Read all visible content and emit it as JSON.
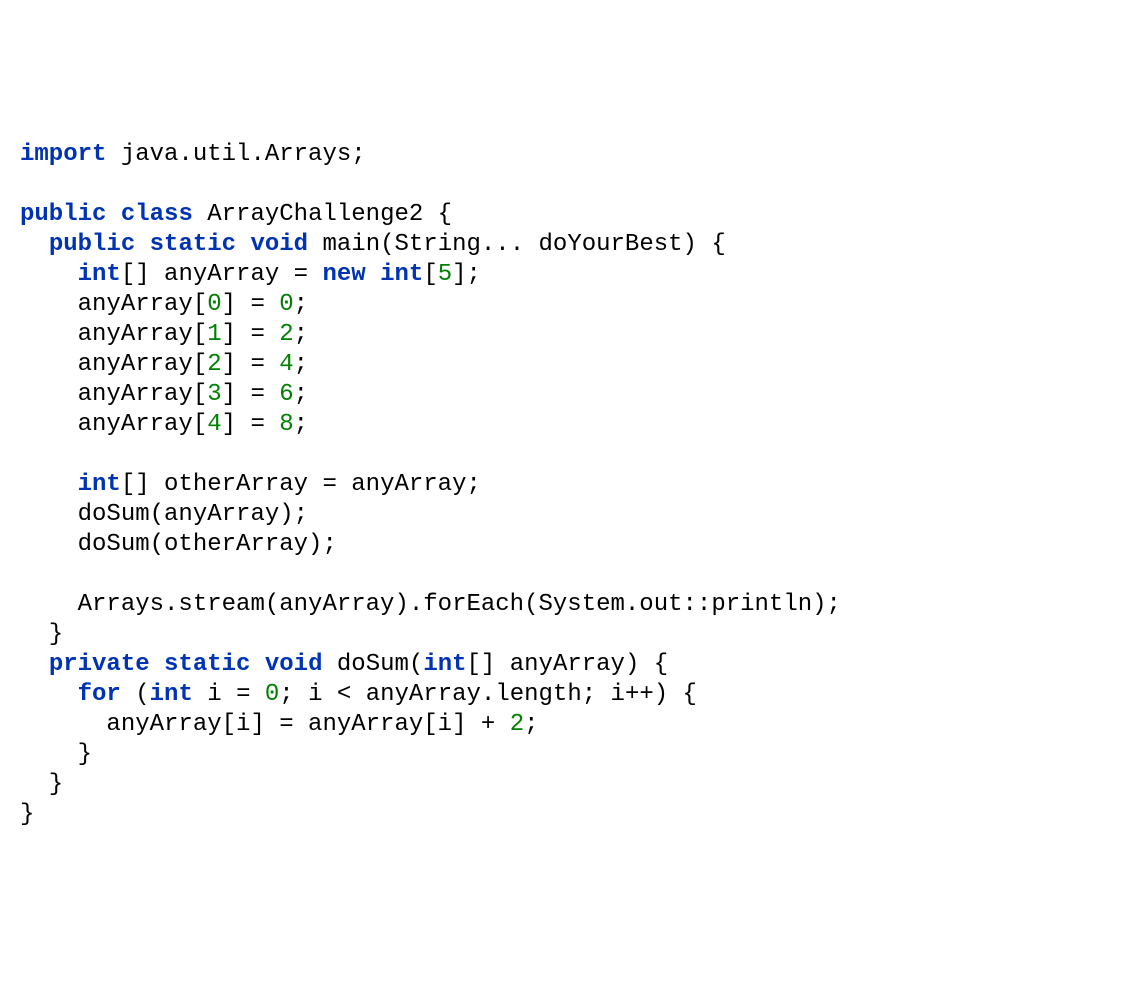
{
  "code": {
    "l1_import": "import",
    "l1_rest": " java.util.Arrays;",
    "l3_public": "public",
    "l3_class": "class",
    "l3_rest": " ArrayChallenge2 {",
    "l4_indent": "  ",
    "l4_public": "public",
    "l4_static": "static",
    "l4_void": "void",
    "l4_rest": " main(String... doYourBest) {",
    "l5_indent": "    ",
    "l5_int": "int",
    "l5_mid": "[] anyArray = ",
    "l5_new": "new",
    "l5_sp": " ",
    "l5_int2": "int",
    "l5_br1": "[",
    "l5_n": "5",
    "l5_br2": "];",
    "l6_indent": "    anyArray[",
    "l6_n": "0",
    "l6_mid": "] = ",
    "l6_v": "0",
    "l6_end": ";",
    "l7_indent": "    anyArray[",
    "l7_n": "1",
    "l7_mid": "] = ",
    "l7_v": "2",
    "l7_end": ";",
    "l8_indent": "    anyArray[",
    "l8_n": "2",
    "l8_mid": "] = ",
    "l8_v": "4",
    "l8_end": ";",
    "l9_indent": "    anyArray[",
    "l9_n": "3",
    "l9_mid": "] = ",
    "l9_v": "6",
    "l9_end": ";",
    "l10_indent": "    anyArray[",
    "l10_n": "4",
    "l10_mid": "] = ",
    "l10_v": "8",
    "l10_end": ";",
    "l12_indent": "    ",
    "l12_int": "int",
    "l12_rest": "[] otherArray = anyArray;",
    "l13": "    doSum(anyArray);",
    "l14": "    doSum(otherArray);",
    "l16": "    Arrays.stream(anyArray).forEach(System.out::println);",
    "l17": "  }",
    "l18_indent": "  ",
    "l18_private": "private",
    "l18_static": "static",
    "l18_void": "void",
    "l18_mid": " doSum(",
    "l18_int": "int",
    "l18_rest": "[] anyArray) {",
    "l19_indent": "    ",
    "l19_for": "for",
    "l19_mid1": " (",
    "l19_int": "int",
    "l19_mid2": " i = ",
    "l19_zero": "0",
    "l19_rest": "; i < anyArray.length; i++) {",
    "l20_indent": "      anyArray[i] = anyArray[i] + ",
    "l20_two": "2",
    "l20_end": ";",
    "l21": "    }",
    "l22": "  }",
    "l23": "}"
  }
}
